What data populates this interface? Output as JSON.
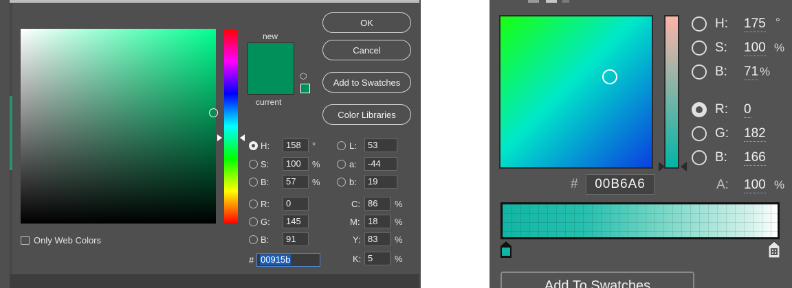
{
  "left": {
    "buttons": {
      "ok": "OK",
      "cancel": "Cancel",
      "add_to_swatches": "Add to Swatches",
      "color_libraries": "Color Libraries"
    },
    "preview": {
      "new_label": "new",
      "current_label": "current",
      "new_color": "#00915b",
      "current_color": "#00915b"
    },
    "only_web_colors": {
      "label": "Only Web Colors",
      "checked": false
    },
    "hsb": {
      "h": {
        "label": "H:",
        "value": "158",
        "unit": "°",
        "selected": true
      },
      "s": {
        "label": "S:",
        "value": "100",
        "unit": "%"
      },
      "b": {
        "label": "B:",
        "value": "57",
        "unit": "%"
      }
    },
    "rgb": {
      "r": {
        "label": "R:",
        "value": "0"
      },
      "g": {
        "label": "G:",
        "value": "145"
      },
      "b": {
        "label": "B:",
        "value": "91"
      }
    },
    "lab": {
      "l": {
        "label": "L:",
        "value": "53"
      },
      "a": {
        "label": "a:",
        "value": "-44"
      },
      "b": {
        "label": "b:",
        "value": "19"
      }
    },
    "cmyk": {
      "c": {
        "label": "C:",
        "value": "86",
        "unit": "%"
      },
      "m": {
        "label": "M:",
        "value": "18",
        "unit": "%"
      },
      "y": {
        "label": "Y:",
        "value": "83",
        "unit": "%"
      },
      "k": {
        "label": "K:",
        "value": "5",
        "unit": "%"
      }
    },
    "hex": {
      "prefix": "#",
      "value": "00915b"
    },
    "icons": {
      "cube": "gamut-cube-icon",
      "web": "web-safe-swatch-icon"
    }
  },
  "right": {
    "hsb": {
      "h": {
        "label": "H:",
        "value": "175",
        "unit": "°"
      },
      "s": {
        "label": "S:",
        "value": "100",
        "unit": "%"
      },
      "b": {
        "label": "B:",
        "value": "71",
        "unit": "%"
      }
    },
    "rgb": {
      "r": {
        "label": "R:",
        "value": "0",
        "selected": true
      },
      "g": {
        "label": "G:",
        "value": "182"
      },
      "b": {
        "label": "B:",
        "value": "166"
      }
    },
    "alpha": {
      "label": "A:",
      "value": "100",
      "unit": "%"
    },
    "hex": {
      "prefix": "#",
      "value": "00B6A6"
    },
    "add_button": "Add To Swatches",
    "color": "#00b6a6"
  }
}
